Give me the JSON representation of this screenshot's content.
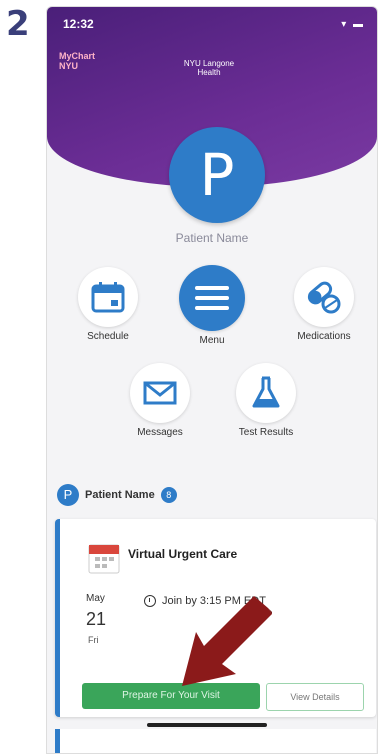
{
  "step_number": "2",
  "status_bar": {
    "time": "12:32",
    "icons": "▾ ▬"
  },
  "logos": {
    "mychart": "MyChart",
    "mychart_sub": "NYU",
    "nyu": "NYU Langone Health"
  },
  "patient": {
    "initial": "P",
    "name": "Patient Name",
    "badge_count": "8"
  },
  "menu": {
    "schedule": "Schedule",
    "menu": "Menu",
    "medications": "Medications",
    "messages": "Messages",
    "test_results": "Test Results"
  },
  "visit_card": {
    "title": "Virtual Urgent Care",
    "month": "May",
    "day": "21",
    "weekday": "Fri",
    "join_text": "Join by 3:15 PM EDT",
    "prepare_button": "Prepare For Your Visit",
    "details_button": "View Details"
  },
  "colors": {
    "purple": "#5a2a89",
    "blue": "#2e7cc8",
    "green": "#3aa55a",
    "arrow": "#8b1a1a"
  }
}
